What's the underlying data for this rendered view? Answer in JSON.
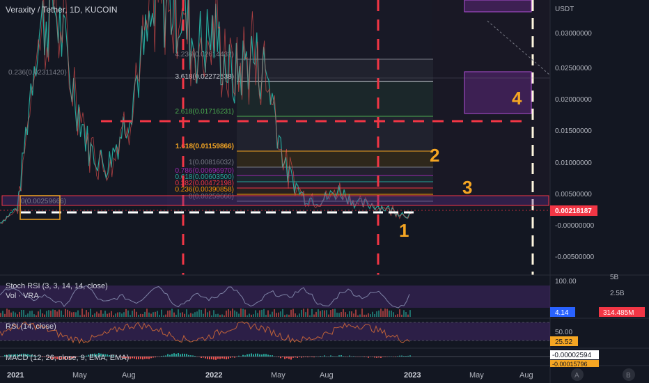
{
  "header": {
    "symbol": "Veraxity / Tether, 1D, KUCOIN"
  },
  "price_axis": {
    "currency": "USDT",
    "ticks": [
      "0.03000000",
      "0.02500000",
      "0.02000000",
      "0.01500000",
      "0.01000000",
      "0.00500000",
      "-0.00000000",
      "-0.00500000"
    ],
    "current_price": "0.00218187"
  },
  "time_axis": {
    "ticks": [
      "2021",
      "May",
      "Aug",
      "2022",
      "May",
      "Aug",
      "2023",
      "May",
      "Aug"
    ]
  },
  "fib_levels": [
    {
      "label": "4.236(0.02614432)",
      "color": "#787b86"
    },
    {
      "label": "3.618(0.02272538)",
      "color": "#d1d4dc"
    },
    {
      "label": "2.618(0.01716231)",
      "color": "#4caf50"
    },
    {
      "label": "1.618(0.01159866)",
      "color": "#f5a623"
    },
    {
      "label": "1(0.00816032)",
      "color": "#787b86"
    },
    {
      "label": "0.786(0.00696970)",
      "color": "#9c27b0"
    },
    {
      "label": "0.618(0.00603500)",
      "color": "#26a69a"
    },
    {
      "label": "0.382(0.00472198)",
      "color": "#f23645"
    },
    {
      "label": "0.236(0.00390858)",
      "color": "#ff9800"
    },
    {
      "label": "0(0.00259666)",
      "color": "#787b86"
    }
  ],
  "left_fib": {
    "label_236": "0.236(0.02311420)",
    "label_0": "0(0.00259666)"
  },
  "annotations": [
    "1",
    "2",
    "3",
    "4"
  ],
  "indicators": {
    "stoch_rsi": {
      "title": "Stoch RSI (3, 3, 14, 14, close)",
      "axis_top": "100.00",
      "value": "4.14"
    },
    "volume": {
      "title": "Vol · VRA",
      "axis_5b": "5B",
      "axis_25b": "2.5B",
      "value": "314.485M"
    },
    "rsi": {
      "title": "RSI (14, close)",
      "axis": "50.00",
      "value": "25.52"
    },
    "macd": {
      "title": "MACD (12, 26, close, 9, EMA, EMA)",
      "value1": "-0.00002594",
      "value2": "-0.00015796"
    }
  },
  "corner_buttons": [
    "A",
    "B"
  ],
  "chart_data": {
    "type": "line",
    "title": "Veraxity / Tether, 1D, KUCOIN",
    "x": [
      "2021-01",
      "2021-02",
      "2021-03",
      "2021-04",
      "2021-05",
      "2021-06",
      "2021-07",
      "2021-08",
      "2021-09",
      "2021-10",
      "2021-11",
      "2021-12",
      "2022-01",
      "2022-02",
      "2022-03",
      "2022-04",
      "2022-05",
      "2022-06",
      "2022-07",
      "2022-08",
      "2022-09",
      "2022-10",
      "2022-11",
      "2022-12"
    ],
    "series": [
      {
        "values": [
          0.0012,
          0.0035,
          0.028,
          0.034,
          0.022,
          0.012,
          0.0095,
          0.016,
          0.026,
          0.034,
          0.033,
          0.027,
          0.029,
          0.022,
          0.026,
          0.023,
          0.009,
          0.005,
          0.0045,
          0.006,
          0.004,
          0.0038,
          0.003,
          0.0022
        ]
      }
    ],
    "ylim": [
      -0.0065,
      0.034
    ]
  }
}
